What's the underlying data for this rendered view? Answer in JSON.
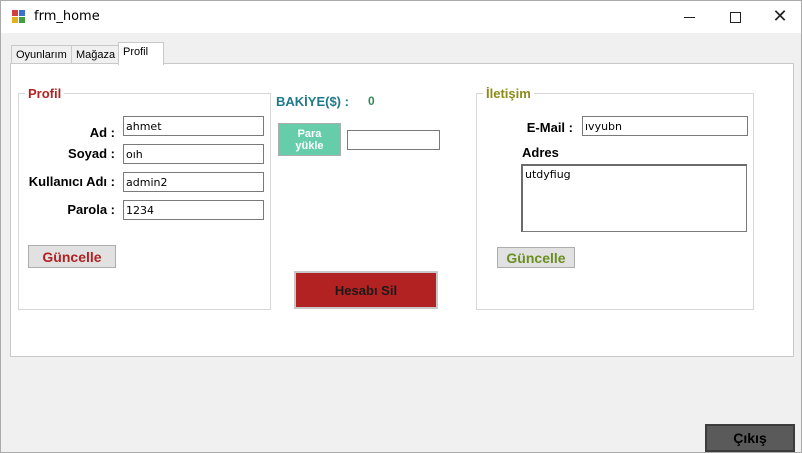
{
  "window": {
    "title": "frm_home",
    "minimize_label": "—",
    "close_label": "✕"
  },
  "tabs": [
    {
      "label": "Oyunlarım"
    },
    {
      "label": "Mağaza"
    },
    {
      "label": "Profil"
    }
  ],
  "profile": {
    "group_title": "Profil",
    "fields": [
      {
        "label": "Ad :",
        "value": "ahmet"
      },
      {
        "label": "Soyad :",
        "value": "oıh"
      },
      {
        "label": "Kullanıcı Adı :",
        "value": "admin2"
      },
      {
        "label": "Parola :",
        "value": "1234"
      }
    ],
    "update_label": "Güncelle"
  },
  "balance": {
    "label": "BAKİYE($) :",
    "value": "0",
    "load_money_label_line1": "Para",
    "load_money_label_line2": "yükle",
    "amount_value": "",
    "delete_account_label": "Hesabı Sil"
  },
  "contact": {
    "group_title": "İletişim",
    "email_label": "E-Mail :",
    "email_value": "ıvyubn",
    "address_label": "Adres",
    "address_value": "utdyfiug",
    "update_label": "Güncelle"
  },
  "exit_label": "Çıkış",
  "colors": {
    "profile_title": "#b22222",
    "profile_update_text": "#b22222",
    "balance_label": "#1f7a8c",
    "balance_value": "#2e8b57",
    "contact_title": "#8b8b1a",
    "contact_update_text": "#6b8e23",
    "load_money_bg": "#66cdaa",
    "delete_bg": "#b22222",
    "exit_bg": "#5a5a5a"
  }
}
